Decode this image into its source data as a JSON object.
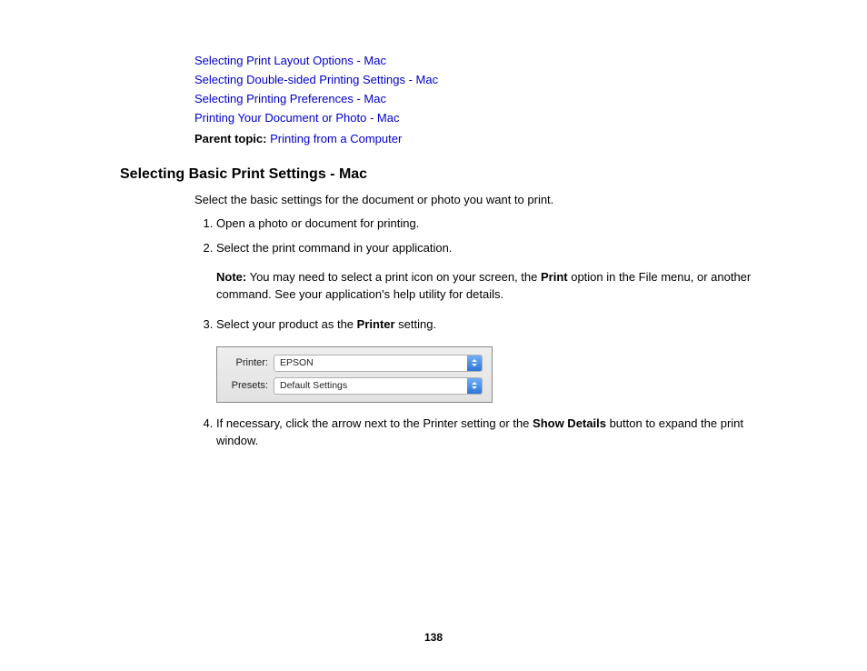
{
  "links": [
    "Selecting Print Layout Options - Mac",
    "Selecting Double-sided Printing Settings - Mac",
    "Selecting Printing Preferences - Mac",
    "Printing Your Document or Photo - Mac"
  ],
  "parent_topic": {
    "label": "Parent topic:",
    "link": "Printing from a Computer"
  },
  "heading": "Selecting Basic Print Settings - Mac",
  "intro": "Select the basic settings for the document or photo you want to print.",
  "steps": {
    "s1": "Open a photo or document for printing.",
    "s2": "Select the print command in your application.",
    "note": {
      "label": "Note:",
      "before": " You may need to select a print icon on your screen, the ",
      "bold1": "Print",
      "after": " option in the File menu, or another command. See your application's help utility for details."
    },
    "s3": {
      "before": "Select your product as the ",
      "bold": "Printer",
      "after": " setting."
    },
    "s4": {
      "before": "If necessary, click the arrow next to the Printer setting or the ",
      "bold": "Show Details",
      "after": " button to expand the print window."
    }
  },
  "dialog": {
    "printer_label": "Printer:",
    "printer_value": "EPSON",
    "presets_label": "Presets:",
    "presets_value": "Default Settings"
  },
  "page_number": "138"
}
